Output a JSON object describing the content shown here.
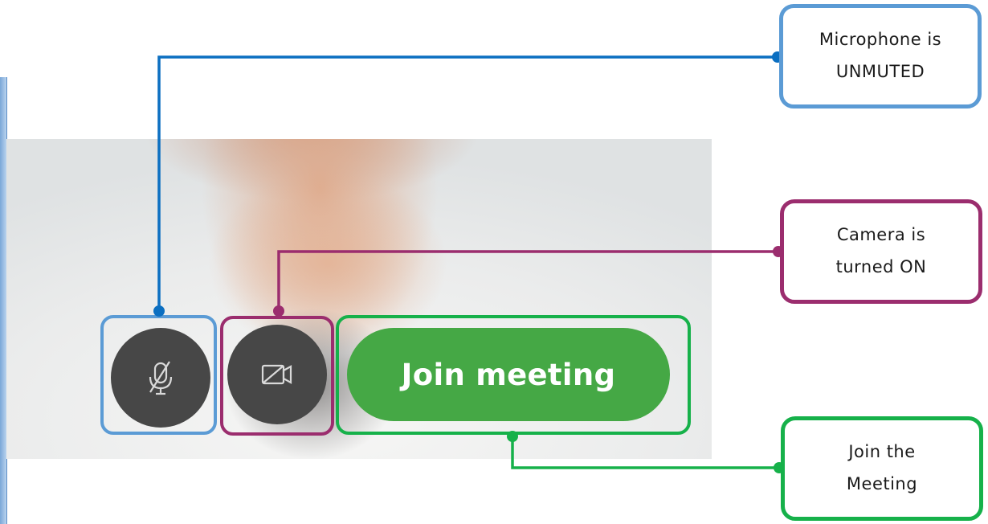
{
  "buttons": {
    "mic": {
      "icon": "microphone-muted-icon",
      "state": "unmuted"
    },
    "camera": {
      "icon": "video-camera-off-icon",
      "state": "on"
    },
    "join": {
      "label": "Join meeting"
    }
  },
  "callouts": {
    "microphone": {
      "line1": "Microphone is",
      "line2": "UNMUTED"
    },
    "camera": {
      "line1": "Camera is",
      "line2": "turned ON"
    },
    "join": {
      "line1": "Join the",
      "line2": "Meeting"
    }
  },
  "colors": {
    "mic_annotation": "#5b9bd5",
    "camera_annotation": "#9b2d6e",
    "join_annotation": "#16b14a",
    "mic_connector": "#0b6fc1",
    "join_button": "#45a845",
    "control_button": "#474747"
  }
}
